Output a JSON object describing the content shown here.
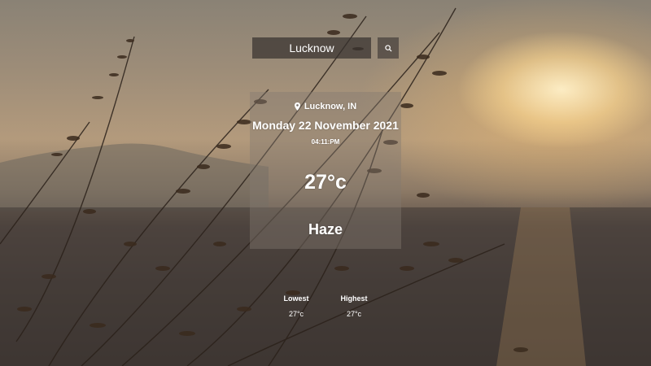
{
  "search": {
    "value": "Lucknow",
    "button_icon": "search-icon"
  },
  "weather": {
    "location": "Lucknow, IN",
    "location_icon": "map-pin-icon",
    "date": "Monday 22 November 2021",
    "time": "04:11:PM",
    "temperature": "27°c",
    "condition": "Haze",
    "lowest_label": "Lowest",
    "lowest_value": "27°c",
    "highest_label": "Highest",
    "highest_value": "27°c"
  },
  "colors": {
    "text": "#ffffff",
    "input_bg": "#37322f",
    "card_bg": "#827a70"
  }
}
